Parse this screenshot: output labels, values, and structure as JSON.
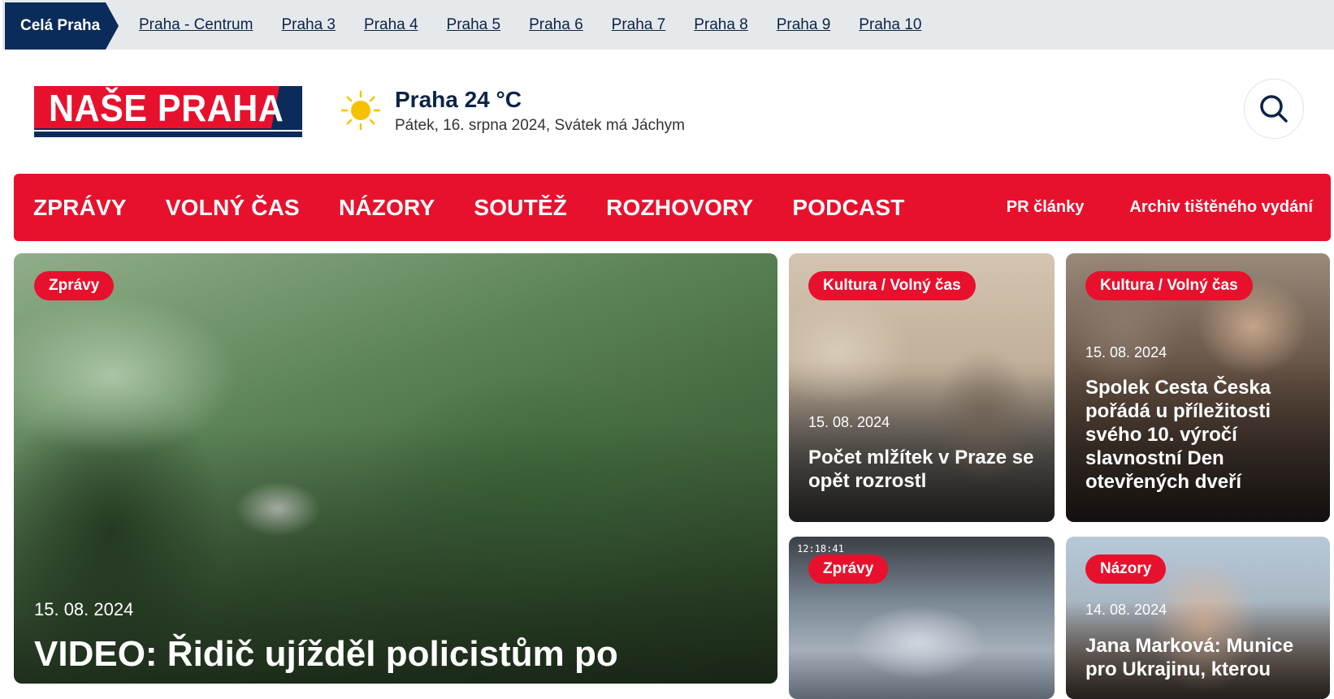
{
  "districts": {
    "active": "Celá Praha",
    "items": [
      "Praha - Centrum",
      "Praha 3",
      "Praha 4",
      "Praha 5",
      "Praha 6",
      "Praha 7",
      "Praha 8",
      "Praha 9",
      "Praha 10"
    ]
  },
  "header": {
    "logo_text": "NAŠE PRAHA",
    "weather_temp": "Praha 24 °C",
    "weather_date": "Pátek, 16. srpna 2024, Svátek má Jáchym",
    "weather_icon": "sun-icon",
    "search_icon": "search-icon"
  },
  "nav": {
    "main": [
      "ZPRÁVY",
      "VOLNÝ ČAS",
      "NÁZORY",
      "SOUTĚŽ",
      "ROZHOVORY",
      "PODCAST"
    ],
    "right": [
      "PR články",
      "Archiv tištěného vydání"
    ]
  },
  "articles": [
    {
      "category": "Zprávy",
      "date": "15. 08. 2024",
      "title": "VIDEO: Řidič ujížděl policistům po"
    },
    {
      "category": "Kultura / Volný čas",
      "date": "15. 08. 2024",
      "title": "Počet mlžítek v Praze se opět rozrostl"
    },
    {
      "category": "Kultura / Volný čas",
      "date": "15. 08. 2024",
      "title": "Spolek Cesta Česka pořádá u příležitosti svého 10. výročí slavnostní Den otevřených dveří"
    },
    {
      "category": "Zprávy",
      "date": "",
      "title": "",
      "timestamp": "12:18:41"
    },
    {
      "category": "Názory",
      "date": "14. 08. 2024",
      "title": "Jana Marková: Munice pro Ukrajinu, kterou"
    }
  ],
  "colors": {
    "brand_red": "#e8112d",
    "brand_navy": "#0b2c5a"
  }
}
